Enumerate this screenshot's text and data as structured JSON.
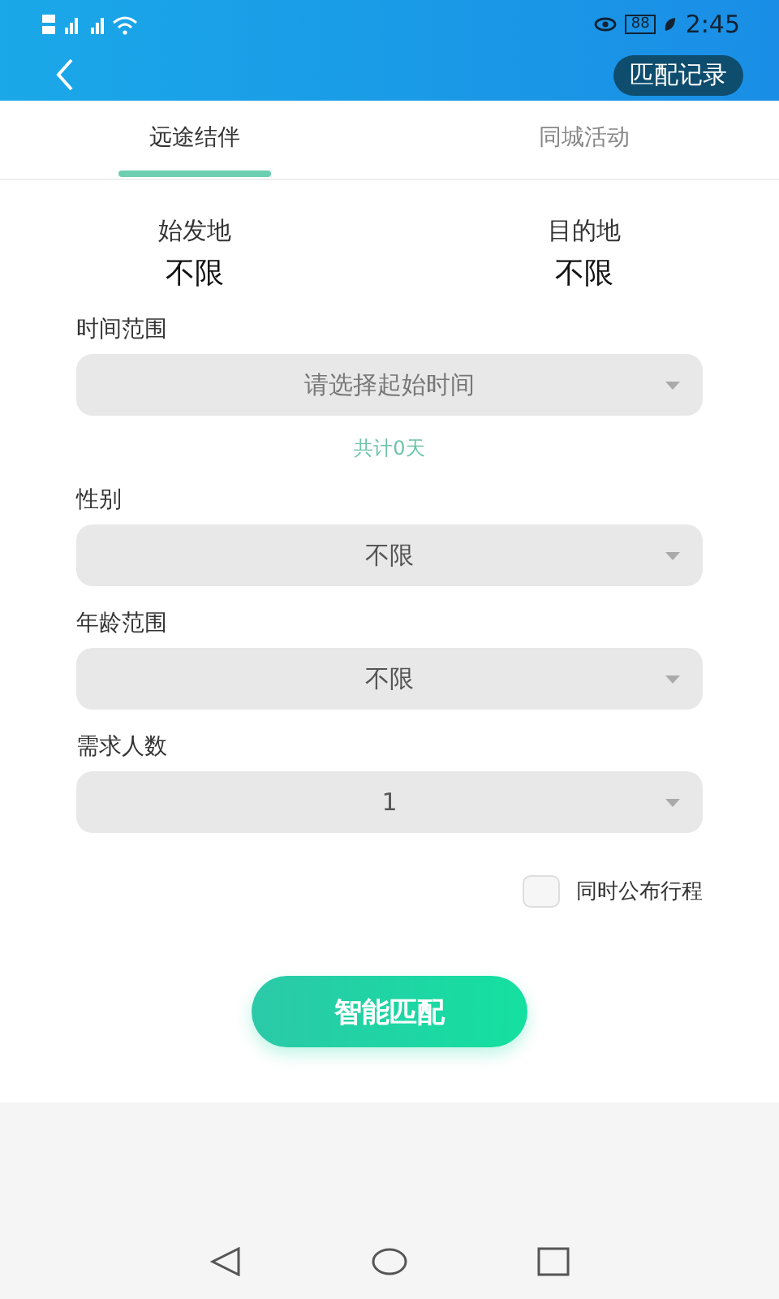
{
  "status_bar": {
    "battery": "88",
    "time": "2:45"
  },
  "header": {
    "button": "匹配记录"
  },
  "tabs": [
    {
      "label": "远途结伴",
      "selected": true
    },
    {
      "label": "同城活动",
      "selected": false
    }
  ],
  "places": [
    {
      "label": "始发地",
      "value": "不限"
    },
    {
      "label": "目的地",
      "value": "不限"
    }
  ],
  "fields": [
    {
      "label": "时间范围",
      "placeholder": "请选择起始时间",
      "note": "共计0天"
    },
    {
      "label": "性别",
      "value": "不限"
    },
    {
      "label": "年龄范围",
      "value": "不限"
    },
    {
      "label": "需求人数",
      "value": "1"
    }
  ],
  "publish": {
    "label": "同时公布行程",
    "checked": false
  },
  "submit": "智能匹配"
}
